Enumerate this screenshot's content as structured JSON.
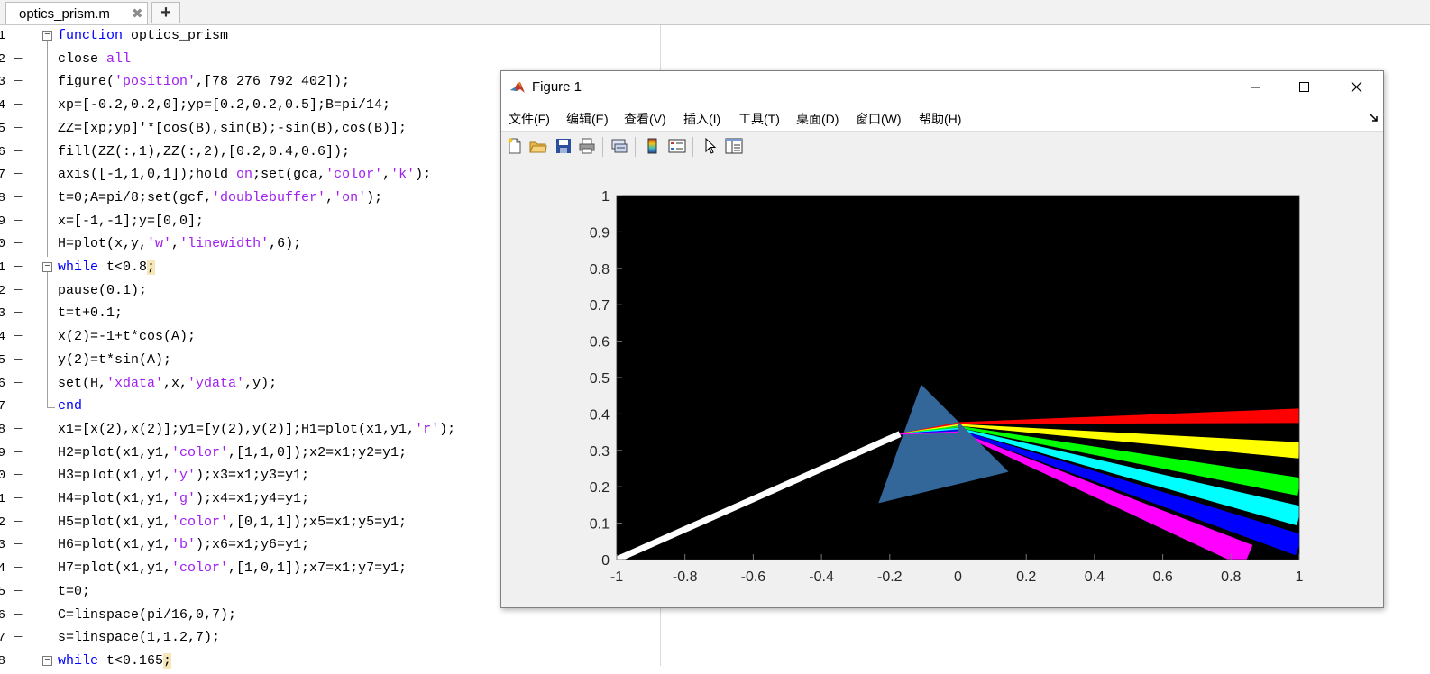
{
  "editor_tab": {
    "filename": "optics_prism.m",
    "close_glyph": "✖",
    "add_glyph": "+"
  },
  "code_lines": [
    {
      "n": "1",
      "dash": "",
      "fold": "minus",
      "tokens": [
        {
          "t": "function",
          "c": "kw"
        },
        {
          "t": " optics_prism",
          "c": ""
        }
      ]
    },
    {
      "n": "2",
      "dash": "—",
      "fold": "",
      "tokens": [
        {
          "t": "close ",
          "c": ""
        },
        {
          "t": "all",
          "c": "str"
        }
      ]
    },
    {
      "n": "3",
      "dash": "—",
      "fold": "",
      "tokens": [
        {
          "t": "figure(",
          "c": ""
        },
        {
          "t": "'position'",
          "c": "str"
        },
        {
          "t": ",[78 276 792 402]);",
          "c": ""
        }
      ]
    },
    {
      "n": "4",
      "dash": "—",
      "fold": "",
      "tokens": [
        {
          "t": "xp=[-0.2,0.2,0];yp=[0.2,0.2,0.5];B=pi/14;",
          "c": ""
        }
      ]
    },
    {
      "n": "5",
      "dash": "—",
      "fold": "",
      "tokens": [
        {
          "t": "ZZ=[xp;yp]'*[cos(B),sin(B);-sin(B),cos(B)];",
          "c": ""
        }
      ]
    },
    {
      "n": "6",
      "dash": "—",
      "fold": "",
      "tokens": [
        {
          "t": "fill(ZZ(:,1),ZZ(:,2),[0.2,0.4,0.6]);",
          "c": ""
        }
      ]
    },
    {
      "n": "7",
      "dash": "—",
      "fold": "",
      "tokens": [
        {
          "t": "axis([-1,1,0,1]);hold ",
          "c": ""
        },
        {
          "t": "on",
          "c": "str"
        },
        {
          "t": ";set(gca,",
          "c": ""
        },
        {
          "t": "'color'",
          "c": "str"
        },
        {
          "t": ",",
          "c": ""
        },
        {
          "t": "'k'",
          "c": "str"
        },
        {
          "t": ");",
          "c": ""
        }
      ]
    },
    {
      "n": "8",
      "dash": "—",
      "fold": "",
      "tokens": [
        {
          "t": "t=0;A=pi/8;set(gcf,",
          "c": ""
        },
        {
          "t": "'doublebuffer'",
          "c": "str"
        },
        {
          "t": ",",
          "c": ""
        },
        {
          "t": "'on'",
          "c": "str"
        },
        {
          "t": ");",
          "c": ""
        }
      ]
    },
    {
      "n": "9",
      "dash": "—",
      "fold": "",
      "tokens": [
        {
          "t": "x=[-1,-1];y=[0,0];",
          "c": ""
        }
      ]
    },
    {
      "n": "10",
      "dash": "—",
      "fold": "",
      "tokens": [
        {
          "t": "H=plot(x,y,",
          "c": ""
        },
        {
          "t": "'w'",
          "c": "str"
        },
        {
          "t": ",",
          "c": ""
        },
        {
          "t": "'linewidth'",
          "c": "str"
        },
        {
          "t": ",6);",
          "c": ""
        }
      ]
    },
    {
      "n": "11",
      "dash": "—",
      "fold": "minus",
      "tokens": [
        {
          "t": "while",
          "c": "kw"
        },
        {
          "t": " t<0.8",
          "c": ""
        },
        {
          "t": ";",
          "c": "hl"
        }
      ]
    },
    {
      "n": "12",
      "dash": "—",
      "fold": "",
      "tokens": [
        {
          "t": "pause(0.1);",
          "c": ""
        }
      ]
    },
    {
      "n": "13",
      "dash": "—",
      "fold": "",
      "tokens": [
        {
          "t": "t=t+0.1;",
          "c": ""
        }
      ]
    },
    {
      "n": "14",
      "dash": "—",
      "fold": "",
      "tokens": [
        {
          "t": "x(2)=-1+t*cos(A);",
          "c": ""
        }
      ]
    },
    {
      "n": "15",
      "dash": "—",
      "fold": "",
      "tokens": [
        {
          "t": "y(2)=t*sin(A);",
          "c": ""
        }
      ]
    },
    {
      "n": "16",
      "dash": "—",
      "fold": "",
      "tokens": [
        {
          "t": "set(H,",
          "c": ""
        },
        {
          "t": "'xdata'",
          "c": "str"
        },
        {
          "t": ",x,",
          "c": ""
        },
        {
          "t": "'ydata'",
          "c": "str"
        },
        {
          "t": ",y);",
          "c": ""
        }
      ]
    },
    {
      "n": "17",
      "dash": "—",
      "fold": "end",
      "tokens": [
        {
          "t": "end",
          "c": "kw"
        }
      ]
    },
    {
      "n": "18",
      "dash": "—",
      "fold": "",
      "tokens": [
        {
          "t": "x1=[x(2),x(2)];y1=[y(2),y(2)];H1=plot(x1,y1,",
          "c": ""
        },
        {
          "t": "'r'",
          "c": "str"
        },
        {
          "t": ");",
          "c": ""
        }
      ]
    },
    {
      "n": "19",
      "dash": "—",
      "fold": "",
      "tokens": [
        {
          "t": "H2=plot(x1,y1,",
          "c": ""
        },
        {
          "t": "'color'",
          "c": "str"
        },
        {
          "t": ",[1,1,0]);x2=x1;y2=y1;",
          "c": ""
        }
      ]
    },
    {
      "n": "20",
      "dash": "—",
      "fold": "",
      "tokens": [
        {
          "t": "H3=plot(x1,y1,",
          "c": ""
        },
        {
          "t": "'y'",
          "c": "str"
        },
        {
          "t": ");x3=x1;y3=y1;",
          "c": ""
        }
      ]
    },
    {
      "n": "21",
      "dash": "—",
      "fold": "",
      "tokens": [
        {
          "t": "H4=plot(x1,y1,",
          "c": ""
        },
        {
          "t": "'g'",
          "c": "str"
        },
        {
          "t": ");x4=x1;y4=y1;",
          "c": ""
        }
      ]
    },
    {
      "n": "22",
      "dash": "—",
      "fold": "",
      "tokens": [
        {
          "t": "H5=plot(x1,y1,",
          "c": ""
        },
        {
          "t": "'color'",
          "c": "str"
        },
        {
          "t": ",[0,1,1]);x5=x1;y5=y1;",
          "c": ""
        }
      ]
    },
    {
      "n": "23",
      "dash": "—",
      "fold": "",
      "tokens": [
        {
          "t": "H6=plot(x1,y1,",
          "c": ""
        },
        {
          "t": "'b'",
          "c": "str"
        },
        {
          "t": ");x6=x1;y6=y1;",
          "c": ""
        }
      ]
    },
    {
      "n": "24",
      "dash": "—",
      "fold": "",
      "tokens": [
        {
          "t": "H7=plot(x1,y1,",
          "c": ""
        },
        {
          "t": "'color'",
          "c": "str"
        },
        {
          "t": ",[1,0,1]);x7=x1;y7=y1;",
          "c": ""
        }
      ]
    },
    {
      "n": "25",
      "dash": "—",
      "fold": "",
      "tokens": [
        {
          "t": "t=0;",
          "c": ""
        }
      ]
    },
    {
      "n": "26",
      "dash": "—",
      "fold": "",
      "tokens": [
        {
          "t": "C=linspace(pi/16,0,7);",
          "c": ""
        }
      ]
    },
    {
      "n": "27",
      "dash": "—",
      "fold": "",
      "tokens": [
        {
          "t": "s=linspace(1,1.2,7);",
          "c": ""
        }
      ]
    },
    {
      "n": "28",
      "dash": "—",
      "fold": "minus",
      "tokens": [
        {
          "t": "while",
          "c": "kw"
        },
        {
          "t": " t<0.165",
          "c": ""
        },
        {
          "t": ";",
          "c": "hl"
        }
      ]
    }
  ],
  "figure_window": {
    "title": "Figure 1",
    "menu": [
      "文件(F)",
      "编辑(E)",
      "查看(V)",
      "插入(I)",
      "工具(T)",
      "桌面(D)",
      "窗口(W)",
      "帮助(H)"
    ],
    "toolbar_icons": [
      "new-figure-icon",
      "open-file-icon",
      "save-icon",
      "print-icon",
      "link-icon",
      "colorbar-icon",
      "legend-icon",
      "pointer-icon",
      "property-inspector-icon"
    ]
  },
  "chart_data": {
    "type": "line",
    "axes_background": "#000000",
    "xlim": [
      -1,
      1
    ],
    "ylim": [
      0,
      1
    ],
    "x_ticks": [
      "-1",
      "-0.8",
      "-0.6",
      "-0.4",
      "-0.2",
      "0",
      "0.2",
      "0.4",
      "0.6",
      "0.8",
      "1"
    ],
    "y_ticks": [
      "0",
      "0.1",
      "0.2",
      "0.3",
      "0.4",
      "0.5",
      "0.6",
      "0.7",
      "0.8",
      "0.9",
      "1"
    ],
    "prism": {
      "color": "#336699",
      "vertices": [
        [
          -0.233,
          0.155
        ],
        [
          0.148,
          0.241
        ],
        [
          -0.108,
          0.481
        ]
      ]
    },
    "incident_beam": {
      "color": "#ffffff",
      "points": [
        [
          -1,
          0
        ],
        [
          -0.17,
          0.345
        ]
      ]
    },
    "rays": [
      {
        "color": "#ff0000",
        "start": [
          0,
          0.375
        ],
        "end": [
          1,
          0.395
        ]
      },
      {
        "color": "#ffff00",
        "start": [
          0,
          0.37
        ],
        "end": [
          1,
          0.3
        ]
      },
      {
        "color": "#00ff00",
        "start": [
          0,
          0.365
        ],
        "end": [
          1,
          0.2
        ]
      },
      {
        "color": "#00ffff",
        "start": [
          0,
          0.36
        ],
        "end": [
          1,
          0.12
        ]
      },
      {
        "color": "#0000ff",
        "start": [
          0,
          0.355
        ],
        "end": [
          1,
          0.04
        ]
      },
      {
        "color": "#ff00ff",
        "start": [
          0,
          0.35
        ],
        "end": [
          0.85,
          0.01
        ]
      }
    ]
  }
}
